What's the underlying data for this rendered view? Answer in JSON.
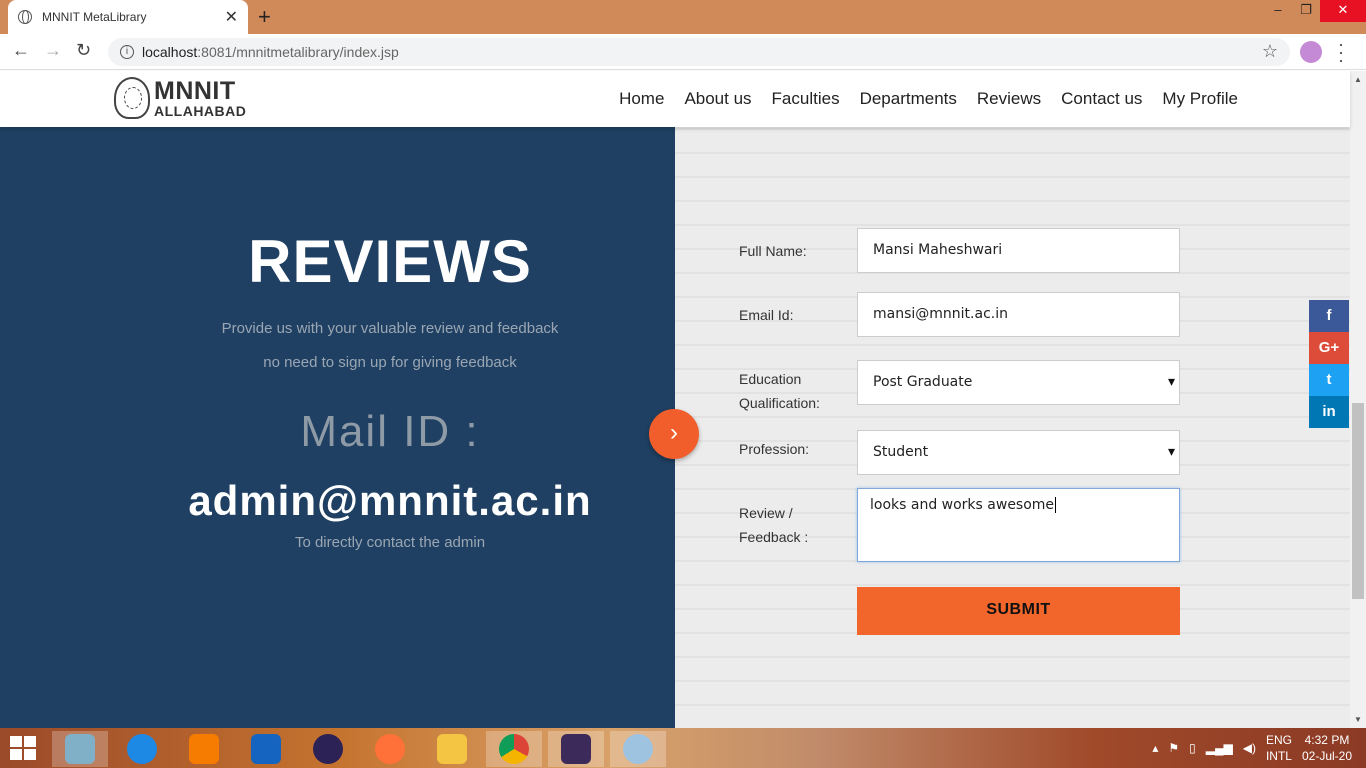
{
  "browser": {
    "tab_title": "MNNIT MetaLibrary",
    "tab_close": "✕",
    "new_tab": "+",
    "url_host": "localhost",
    "url_path": ":8081/mnnitmetalibrary/index.jsp",
    "win_minimize": "–",
    "win_restore": "❐",
    "win_close": "✕"
  },
  "header": {
    "logo_top": "MNNIT",
    "logo_bottom": "ALLAHABAD",
    "menu": [
      "Home",
      "About us",
      "Faculties",
      "Departments",
      "Reviews",
      "Contact us",
      "My Profile"
    ]
  },
  "left": {
    "title": "REVIEWS",
    "subtitle1": "Provide us with your valuable review and feedback",
    "subtitle2": "no need to sign up for giving feedback",
    "mail_label": "Mail ID :",
    "mail_id": "admin@mnnit.ac.in",
    "mail_note": "To directly contact the admin",
    "arrow": "›"
  },
  "form": {
    "full_name_label": "Full Name:",
    "full_name_value": "Mansi Maheshwari",
    "email_label": "Email Id:",
    "email_value": "mansi@mnnit.ac.in",
    "education_label_1": "Education",
    "education_label_2": "Qualification:",
    "education_value": "Post Graduate",
    "profession_label": "Profession:",
    "profession_value": "Student",
    "review_label_1": "Review /",
    "review_label_2": "Feedback :",
    "review_value": "looks and works awesome",
    "submit": "SUBMIT"
  },
  "social": {
    "facebook": "f",
    "google_plus": "G+",
    "twitter": "t",
    "linkedin": "in"
  },
  "taskbar": {
    "lang_1": "ENG",
    "lang_2": "INTL",
    "time": "4:32 PM",
    "date": "02-Jul-20"
  },
  "colors": {
    "left_panel": "#1f4062",
    "accent": "#f2652b"
  }
}
